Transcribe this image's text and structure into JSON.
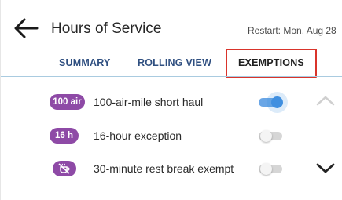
{
  "header": {
    "title": "Hours of Service",
    "restart": "Restart: Mon, Aug 28"
  },
  "tabs": [
    {
      "label": "SUMMARY"
    },
    {
      "label": "ROLLING VIEW"
    },
    {
      "label": "EXEMPTIONS",
      "selected": true
    }
  ],
  "exemptions": [
    {
      "badge": "100 air",
      "label": "100-air-mile short haul",
      "enabled": true
    },
    {
      "badge": "16 h",
      "label": "16-hour exception",
      "enabled": false
    },
    {
      "badge_icon": "no-coffee-icon",
      "label": "30-minute rest break exempt",
      "enabled": false
    }
  ],
  "colors": {
    "badge": "#8e4aa6",
    "tab_text": "#2f4f80",
    "toggle_on": "#3f8fe0",
    "highlight": "#d9342b"
  }
}
